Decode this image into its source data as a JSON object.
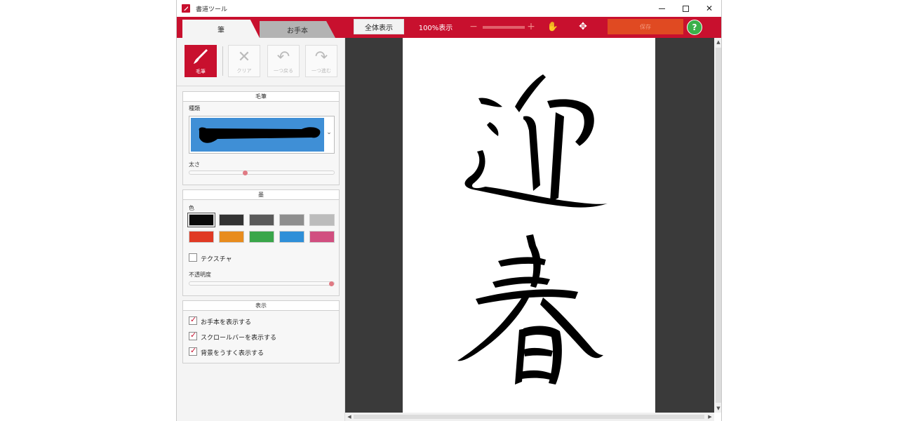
{
  "window": {
    "title": "書道ツール",
    "controls": {
      "minimize_icon": "minimize-icon",
      "maximize_icon": "maximize-icon",
      "close_icon": "close-icon"
    }
  },
  "tabs": [
    {
      "label": "筆",
      "active": true
    },
    {
      "label": "お手本",
      "active": false
    }
  ],
  "toolbar": {
    "fit_label": "全体表示",
    "zoom100_label": "100%表示",
    "zoom_minus": "−",
    "zoom_plus": "+",
    "save_label": "保存",
    "help_label": "?",
    "colors": {
      "accent": "#c8102e",
      "help": "#3bb04a"
    }
  },
  "tools": [
    {
      "label": "毛筆",
      "icon": "brush-icon",
      "active": true
    },
    {
      "label": "クリア",
      "icon": "clear-icon",
      "active": false
    },
    {
      "label": "一つ戻る",
      "icon": "undo-icon",
      "active": false
    },
    {
      "label": "一つ進む",
      "icon": "redo-icon",
      "active": false
    }
  ],
  "brush_group": {
    "header": "毛筆",
    "type_label": "種類",
    "thickness_label": "太さ",
    "thickness_value": 0.38
  },
  "ink_group": {
    "header": "墨",
    "color_label": "色",
    "swatches": [
      "#0a0a0a",
      "#333333",
      "#5a5a5a",
      "#8e8e8e",
      "#bcbcbc",
      "#e03a24",
      "#e88c1e",
      "#3aa64a",
      "#2f8fd8",
      "#d14f80"
    ],
    "selected_swatch": 0,
    "texture_label": "テクスチャ",
    "texture_checked": false,
    "opacity_label": "不透明度",
    "opacity_value": 1.0
  },
  "display_group": {
    "header": "表示",
    "options": [
      {
        "label": "お手本を表示する",
        "checked": true
      },
      {
        "label": "スクロールバーを表示する",
        "checked": true
      },
      {
        "label": "背景をうすく表示する",
        "checked": true
      }
    ]
  },
  "canvas": {
    "characters": [
      "迎",
      "春"
    ]
  }
}
